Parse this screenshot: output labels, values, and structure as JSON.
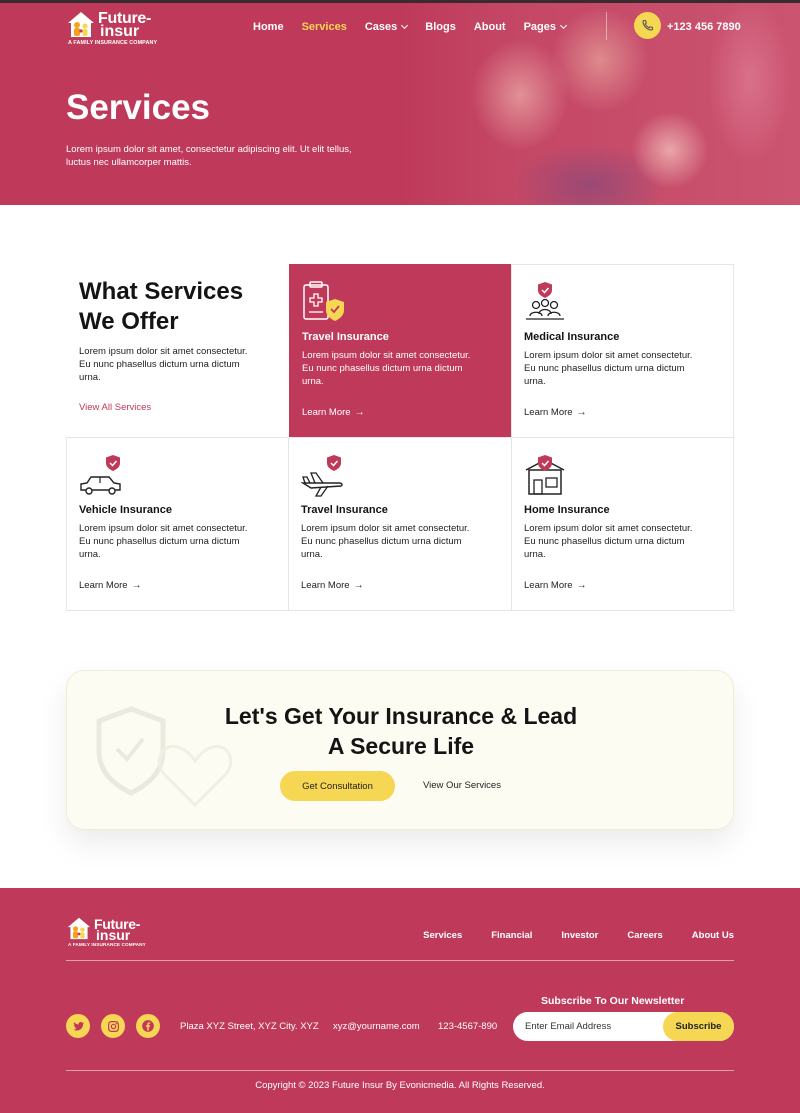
{
  "brand": {
    "name_line1": "Future-",
    "name_line2": "insur",
    "tagline": "A FAMILY INSURANCE COMPANY"
  },
  "nav": {
    "items": [
      {
        "label": "Home",
        "active": false,
        "dropdown": false
      },
      {
        "label": "Services",
        "active": true,
        "dropdown": false
      },
      {
        "label": "Cases",
        "active": false,
        "dropdown": true
      },
      {
        "label": "Blogs",
        "active": false,
        "dropdown": false
      },
      {
        "label": "About",
        "active": false,
        "dropdown": false
      },
      {
        "label": "Pages",
        "active": false,
        "dropdown": true
      }
    ],
    "phone": "+123 456 7890",
    "phone_icon": "phone-icon"
  },
  "hero": {
    "title": "Services",
    "description": "Lorem ipsum dolor sit amet, consectetur adipiscing elit. Ut elit tellus, luctus nec ullamcorper mattis."
  },
  "services_section": {
    "title_line1": "What Services",
    "title_line2": "We Offer",
    "description": "Lorem ipsum dolor sit amet consectetur. Eu nunc phasellus dictum urna dictum urna.",
    "view_all": "View All Services",
    "items": [
      {
        "title": "Travel Insurance",
        "description": "Lorem ipsum dolor sit amet consectetur. Eu nunc phasellus dictum urna dictum urna.",
        "link": "Learn More",
        "icon": "clipboard-shield-icon",
        "featured": true
      },
      {
        "title": "Medical Insurance",
        "description": "Lorem ipsum dolor sit amet consectetur. Eu nunc phasellus dictum urna dictum urna.",
        "link": "Learn More",
        "icon": "family-shield-icon",
        "featured": false
      },
      {
        "title": "Vehicle Insurance",
        "description": "Lorem ipsum dolor sit amet consectetur. Eu nunc phasellus dictum urna dictum urna.",
        "link": "Learn More",
        "icon": "car-shield-icon",
        "featured": false
      },
      {
        "title": "Travel Insurance",
        "description": "Lorem ipsum dolor sit amet consectetur. Eu nunc phasellus dictum urna dictum urna.",
        "link": "Learn More",
        "icon": "airplane-shield-icon",
        "featured": false
      },
      {
        "title": "Home Insurance",
        "description": "Lorem ipsum dolor sit amet consectetur. Eu nunc phasellus dictum urna dictum urna.",
        "link": "Learn More",
        "icon": "house-shield-icon",
        "featured": false
      }
    ]
  },
  "cta": {
    "title_line1": "Let's Get Your Insurance & Lead",
    "title_line2": "A Secure Life",
    "primary_button": "Get Consultation",
    "secondary_link": "View Our Services"
  },
  "footer": {
    "nav": [
      "Services",
      "Financial",
      "Investor",
      "Careers",
      "About Us"
    ],
    "social": [
      "twitter-icon",
      "instagram-icon",
      "facebook-icon"
    ],
    "address": "Plaza XYZ Street, XYZ City. XYZ",
    "email": "xyz@yourname.com",
    "phone": "123-4567-890",
    "newsletter_title": "Subscribe To Our Newsletter",
    "newsletter_placeholder": "Enter Email Address",
    "newsletter_button": "Subscribe",
    "copyright": "Copyright © 2023 Future Insur By Evonicmedia. All Rights Reserved."
  },
  "colors": {
    "primary": "#bf3a5a",
    "accent": "#f6d754",
    "cta_bg": "#fcfcf2",
    "text_dark": "#141414"
  }
}
